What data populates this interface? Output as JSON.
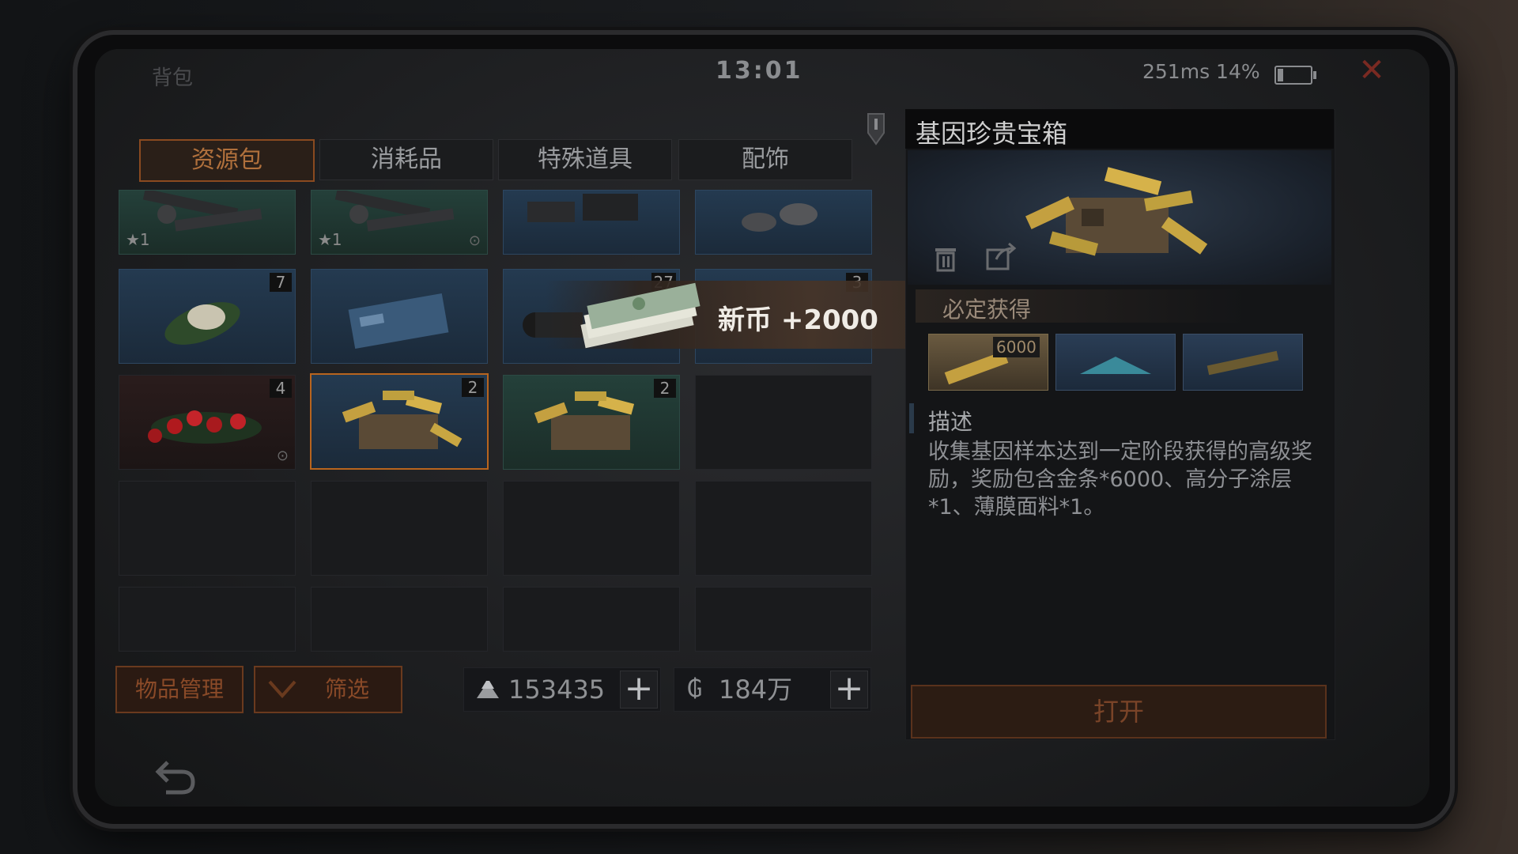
{
  "header": {
    "title": "背包",
    "clock": "13:01",
    "network": "251ms 14%",
    "close_icon": "close-icon"
  },
  "tabs": [
    {
      "label": "资源包",
      "active": true
    },
    {
      "label": "消耗品",
      "active": false
    },
    {
      "label": "特殊道具",
      "active": false
    },
    {
      "label": "配饰",
      "active": false
    }
  ],
  "grid": {
    "rows": [
      [
        {
          "item": "turret-parts",
          "star": "★1"
        },
        {
          "item": "turret-parts",
          "star": "★1"
        },
        {
          "item": "metal-parts"
        },
        {
          "item": "bolts"
        }
      ],
      [
        {
          "item": "herb-bundle",
          "count": "7"
        },
        {
          "item": "blue-card"
        },
        {
          "item": "bomb-cylinder",
          "count": "27"
        },
        {
          "item": "unknown",
          "count": "3"
        }
      ],
      [
        {
          "item": "berries",
          "count": "4"
        },
        {
          "item": "gold-chest",
          "count": "2",
          "selected": true
        },
        {
          "item": "gold-chest-green",
          "count": "2"
        },
        {
          "item": "empty"
        }
      ]
    ]
  },
  "toast": {
    "text": "新币 +2000"
  },
  "bottom_bar": {
    "manage_label": "物品管理",
    "filter_label": "筛选",
    "currency1": "153435",
    "currency2": "184万"
  },
  "detail": {
    "title": "基因珍贵宝箱",
    "guarantee_label": "必定获得",
    "reward_qty": "6000",
    "desc_label": "描述",
    "desc_text": "收集基因样本达到一定阶段获得的高级奖励，奖励包含金条*6000、高分子涂层*1、薄膜面料*1。",
    "open_label": "打开"
  },
  "footer": {
    "back_icon": "back-arrow-icon"
  },
  "colors": {
    "accent_orange": "#b8641e",
    "panel_bg": "#141517"
  }
}
